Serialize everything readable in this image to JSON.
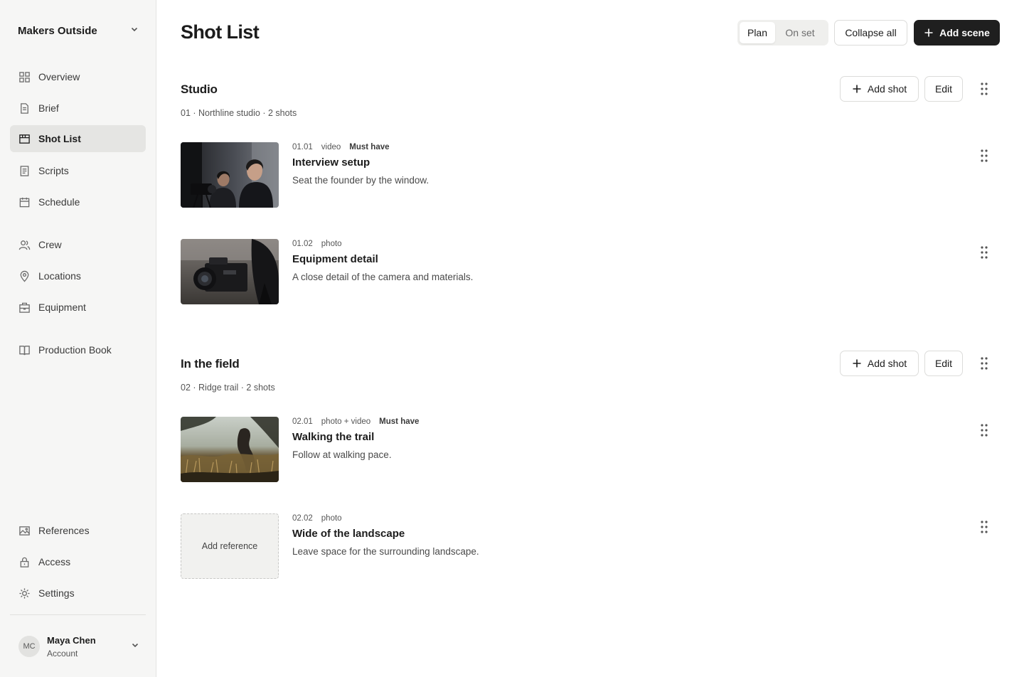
{
  "sidebar": {
    "workspace": "Makers Outside",
    "nav": [
      {
        "label": "Overview",
        "icon": "grid-icon"
      },
      {
        "label": "Brief",
        "icon": "document-icon"
      },
      {
        "label": "Shot List",
        "icon": "film-icon",
        "active": true
      },
      {
        "label": "Scripts",
        "icon": "script-icon"
      },
      {
        "label": "Schedule",
        "icon": "calendar-icon"
      },
      {
        "label": "Crew",
        "icon": "users-icon"
      },
      {
        "label": "Locations",
        "icon": "map-pin-icon"
      },
      {
        "label": "Equipment",
        "icon": "toolbox-icon"
      },
      {
        "label": "Production Book",
        "icon": "book-icon"
      },
      {
        "label": "References",
        "icon": "image-icon"
      },
      {
        "label": "Access",
        "icon": "lock-icon"
      },
      {
        "label": "Settings",
        "icon": "gear-icon"
      }
    ],
    "user": {
      "initials": "MC",
      "name": "Maya Chen",
      "sub": "Account"
    }
  },
  "header": {
    "title": "Shot List",
    "mode_plan": "Plan",
    "mode_onset": "On set",
    "collapse": "Collapse all",
    "add_scene": "Add scene"
  },
  "scenes": [
    {
      "title": "Studio",
      "meta": "01 · Northline studio · 2 shots",
      "add_shot": "Add shot",
      "edit": "Edit",
      "shots": [
        {
          "num": "01.01",
          "type": "video",
          "must": "Must have",
          "title": "Interview setup",
          "desc": "Seat the founder by the window."
        },
        {
          "num": "01.02",
          "type": "photo",
          "must": "",
          "title": "Equipment detail",
          "desc": "A close detail of the camera and materials."
        }
      ]
    },
    {
      "title": "In the field",
      "meta": "02 · Ridge trail · 2 shots",
      "add_shot": "Add shot",
      "edit": "Edit",
      "shots": [
        {
          "num": "02.01",
          "type": "photo + video",
          "must": "Must have",
          "title": "Walking the trail",
          "desc": "Follow at walking pace."
        },
        {
          "num": "02.02",
          "type": "photo",
          "must": "",
          "title": "Wide of the landscape",
          "desc": "Leave space for the surrounding landscape.",
          "placeholder": "Add reference"
        }
      ]
    }
  ],
  "colors": {
    "accent_dark": "#1f1f1f",
    "sidebar_bg": "#f6f6f5",
    "active_bg": "#e5e5e3"
  }
}
